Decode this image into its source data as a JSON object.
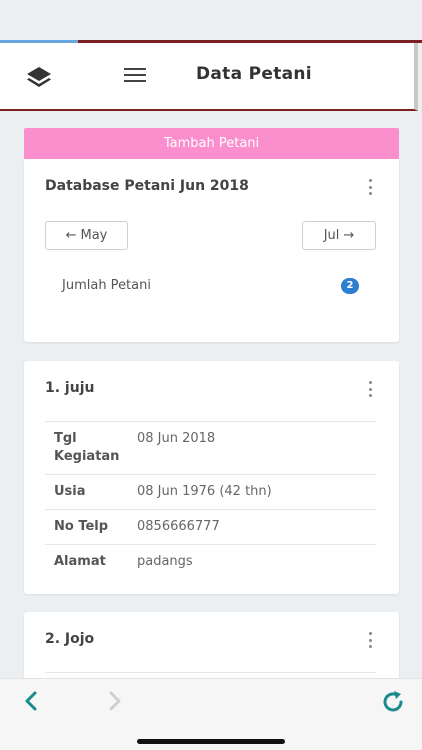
{
  "header": {
    "title": "Data Petani",
    "layers_icon": "layers-icon",
    "menu_icon": "hamburger-menu-icon"
  },
  "add_button": {
    "label": "Tambah Petani"
  },
  "summary_card": {
    "title": "Database Petani Jun 2018",
    "prev": {
      "arrow": "←",
      "label": "May"
    },
    "next": {
      "label": "Jul",
      "arrow": "→"
    },
    "count_label": "Jumlah Petani",
    "count_value": "2"
  },
  "farmers": [
    {
      "title": "1. juju",
      "details": [
        {
          "key": "Tgl Kegiatan",
          "value": "08 Jun 2018"
        },
        {
          "key": "Usia",
          "value": "08 Jun 1976 (42 thn)"
        },
        {
          "key": "No Telp",
          "value": "0856666777"
        },
        {
          "key": "Alamat",
          "value": "padangs"
        }
      ]
    },
    {
      "title": "2. Jojo"
    }
  ],
  "browser_bar": {
    "back_icon": "chevron-left-icon",
    "forward_icon": "chevron-right-icon",
    "reload_icon": "reload-icon"
  },
  "colors": {
    "accent_pink": "#fb8fcd",
    "header_border": "#7a1f22",
    "badge_blue": "#2d7fd0",
    "nav_teal": "#1a8a8a"
  }
}
